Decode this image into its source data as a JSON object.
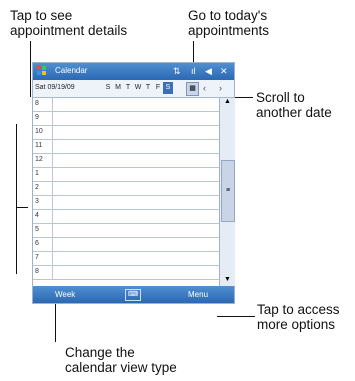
{
  "callouts": {
    "see_details": "Tap to see\nappointment details",
    "today": "Go to today's\nappointments",
    "scroll": "Scroll to\nanother date",
    "options": "Tap to access\nmore options",
    "view": "Change the\ncalendar view type"
  },
  "device": {
    "title": "Calendar",
    "date_label": "Sat 09/19/09",
    "days": [
      "S",
      "M",
      "T",
      "W",
      "T",
      "F",
      "S"
    ],
    "hours": [
      "8",
      "9",
      "10",
      "11",
      "12",
      "1",
      "2",
      "3",
      "4",
      "5",
      "6",
      "7",
      "8"
    ],
    "menu_left": "Week",
    "menu_right": "Menu"
  }
}
